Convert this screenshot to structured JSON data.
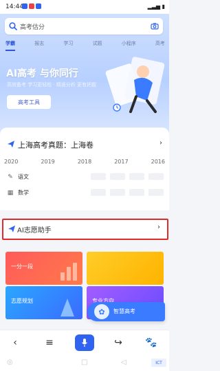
{
  "status": {
    "time": "14:44"
  },
  "search": {
    "placeholder": "高考估分"
  },
  "tabs": [
    "学霸",
    "报志",
    "学习",
    "试题",
    "小程序",
    "高考"
  ],
  "banner": {
    "title": "AI高考 与你同行",
    "subtitle": "高效备考 学习更轻松 · 精准分析 更有把握",
    "button": "高考工具"
  },
  "exam_card": {
    "title": "上海高考真题：上海卷",
    "years": [
      "2020",
      "2019",
      "2018",
      "2017",
      "2016"
    ],
    "subjects": [
      "语文",
      "数学"
    ]
  },
  "assistant": {
    "label": "AI志愿助手"
  },
  "tiles": {
    "t1": "一分一段",
    "t2": "",
    "t3": "志愿规划",
    "t4": "专业方向"
  },
  "floating": {
    "label": "智慧高考"
  },
  "bottom_bar": {
    "back": "‹",
    "menu": "≡",
    "mic": "🎤",
    "share": "↪",
    "paw": "🐾"
  },
  "sysnav": {
    "home": "◎",
    "recent": "□",
    "back": "◁"
  },
  "watermark": "ICT"
}
